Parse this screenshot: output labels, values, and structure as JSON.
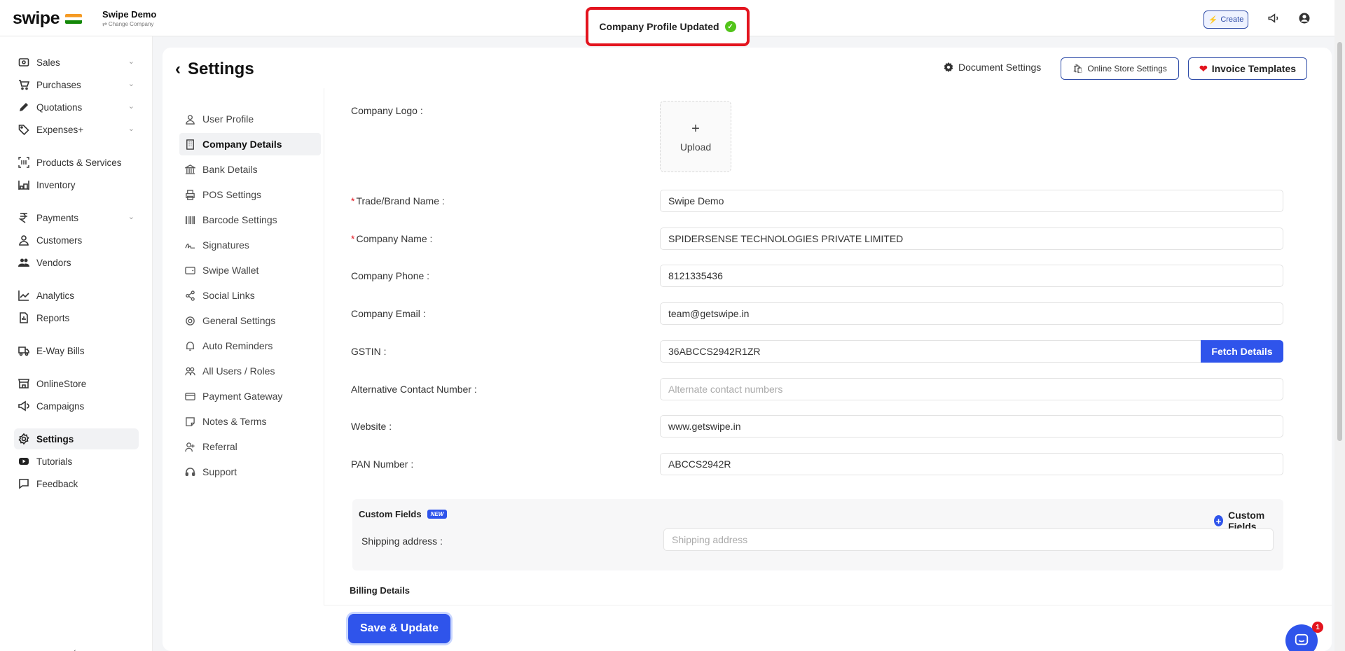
{
  "topbar": {
    "logo": "swipe",
    "company_name": "Swipe Demo",
    "change_company": "⇄ Change Company",
    "toast": "Company Profile Updated",
    "create_label": "Create"
  },
  "leftnav": {
    "items": [
      {
        "label": "Sales",
        "icon": "sales-icon"
      },
      {
        "label": "Purchases",
        "icon": "cart-icon"
      },
      {
        "label": "Quotations",
        "icon": "pencil-icon"
      },
      {
        "label": "Expenses+",
        "icon": "tag-icon"
      },
      {
        "label": "Products & Services",
        "icon": "barcode-icon"
      },
      {
        "label": "Inventory",
        "icon": "inventory-icon"
      },
      {
        "label": "Payments",
        "icon": "rupee-icon"
      },
      {
        "label": "Customers",
        "icon": "user-icon"
      },
      {
        "label": "Vendors",
        "icon": "users-icon"
      },
      {
        "label": "Analytics",
        "icon": "chart-icon"
      },
      {
        "label": "Reports",
        "icon": "report-icon"
      },
      {
        "label": "E-Way Bills",
        "icon": "truck-icon"
      },
      {
        "label": "OnlineStore",
        "icon": "store-icon"
      },
      {
        "label": "Campaigns",
        "icon": "megaphone-icon"
      },
      {
        "label": "Settings",
        "icon": "gear-icon"
      },
      {
        "label": "Tutorials",
        "icon": "youtube-icon"
      },
      {
        "label": "Feedback",
        "icon": "chat-icon"
      }
    ]
  },
  "settings": {
    "title": "Settings",
    "document_settings": "Document Settings",
    "online_store_settings": "Online Store Settings",
    "invoice_templates": "Invoice Templates",
    "submenu": [
      "User Profile",
      "Company Details",
      "Bank Details",
      "POS Settings",
      "Barcode Settings",
      "Signatures",
      "Swipe Wallet",
      "Social Links",
      "General Settings",
      "Auto Reminders",
      "All Users / Roles",
      "Payment Gateway",
      "Notes & Terms",
      "Referral",
      "Support"
    ]
  },
  "form": {
    "company_logo_label": "Company Logo :",
    "upload_label": "Upload",
    "trade_name_label": "Trade/Brand Name :",
    "trade_name_value": "Swipe Demo",
    "company_name_label": "Company Name :",
    "company_name_value": "SPIDERSENSE TECHNOLOGIES PRIVATE LIMITED",
    "phone_label": "Company Phone :",
    "phone_value": "8121335436",
    "email_label": "Company Email :",
    "email_value": "team@getswipe.in",
    "gstin_label": "GSTIN :",
    "gstin_value": "36ABCCS2942R1ZR",
    "fetch_details": "Fetch Details",
    "alt_contact_label": "Alternative Contact Number :",
    "alt_contact_placeholder": "Alternate contact numbers",
    "website_label": "Website :",
    "website_value": "www.getswipe.in",
    "pan_label": "PAN Number :",
    "pan_value": "ABCCS2942R",
    "custom_fields_title": "Custom Fields",
    "new_badge": "NEW",
    "custom_fields_add": "Custom Fields",
    "shipping_label": "Shipping address :",
    "shipping_placeholder": "Shipping address",
    "billing_details": "Billing Details",
    "save_update": "Save & Update"
  },
  "chat": {
    "badge": "1"
  },
  "colors": {
    "accent": "#2f54eb",
    "toast_border": "#e3141e",
    "success": "#52c41a"
  }
}
